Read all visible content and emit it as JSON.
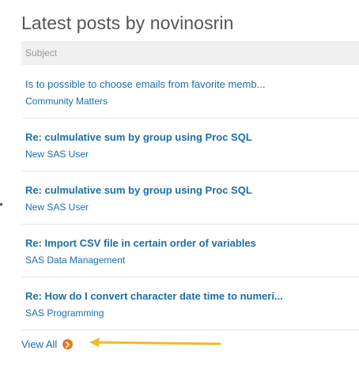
{
  "title": "Latest posts by novinosrin",
  "table": {
    "column_header": "Subject"
  },
  "posts": [
    {
      "title": "Is to possible to choose emails from favorite memb...",
      "board": "Community Matters"
    },
    {
      "title": "Re: culmulative sum by group using Proc SQL",
      "board": "New SAS User"
    },
    {
      "title": "Re: culmulative sum by group using Proc SQL",
      "board": "New SAS User"
    },
    {
      "title": "Re: Import CSV file in certain order of variables",
      "board": "SAS Data Management"
    },
    {
      "title": "Re: How do I convert character date time to numeri...",
      "board": "SAS Programming"
    }
  ],
  "footer": {
    "view_all_label": "View All",
    "view_all_icon": "chevron-right-icon"
  },
  "colors": {
    "link": "#1b6ea8",
    "accent": "#ea7a1c",
    "annotation_arrow": "#f0b92a"
  }
}
